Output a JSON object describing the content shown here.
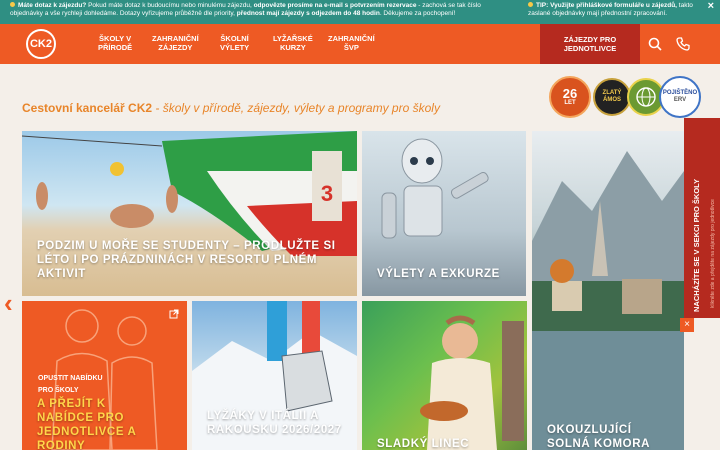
{
  "infobar": {
    "msg1_part1": "Máte dotaz k zájezdu? ",
    "msg1_part2": "Pokud máte dotaz k budoucímu nebo minulému zájezdu, ",
    "msg1_part3": "odpovězte prosíme na e-mail s potvrzením rezervace",
    "msg1_part4": " - zachová se tak číslo objednávky a vše rychleji dohledáme. Dotazy vyřizujeme průběžně dle priority, ",
    "msg1_part5": "přednost mají zájezdy s odjezdem do 48 hodin",
    "msg1_part6": ". Děkujeme za pochopení!",
    "msg2_part1": "TIP: Využijte přihláškové formuláře u zájezdů,",
    "msg2_part2": " takto zaslané objednávky mají přednostní zpracování.",
    "close": "×"
  },
  "nav": {
    "logo": "CK2",
    "items": [
      {
        "l1": "ŠKOLY V",
        "l2": "PŘÍRODĚ"
      },
      {
        "l1": "ZAHRANIČNÍ",
        "l2": "ZÁJEZDY"
      },
      {
        "l1": "ŠKOLNÍ",
        "l2": "VÝLETY"
      },
      {
        "l1": "LYŽAŘSKÉ",
        "l2": "KURZY"
      },
      {
        "l1": "ZAHRANIČNÍ",
        "l2": "ŠVP"
      }
    ],
    "jednotlivce_l1": "ZÁJEZDY PRO",
    "jednotlivce_l2": "JEDNOTLIVCE"
  },
  "heading": {
    "brand": "Cestovní kancelář CK2",
    "sub": " - školy v přírodě, zájezdy, výlety a programy pro školy"
  },
  "badges": {
    "years": "26",
    "years_unit": "LET",
    "zlaty": "ZLATÝ",
    "zlaty2": "ÁMOS",
    "pojisteno": "POJIŠTĚNO",
    "erv": "ERV"
  },
  "tiles": {
    "t1": "PODZIM U MOŘE SE STUDENTY – PRODLUŽTE SI LÉTO I PO PRÁZDNINÁCH V RESORTU PLNÉM AKTIVIT",
    "t2": "VÝLETY A EXKURZE",
    "t3_small1": "OPUSTIT NABÍDKU",
    "t3_small2": "PRO ŠKOLY",
    "t3": "A PŘEJÍT K NABÍDCE PRO JEDNOTLIVCE A RODINY",
    "t4": "LYŽÁKY V ITÁLII A RAKOUSKU 2026/2027",
    "t5": "SLADKÝ LINEC",
    "t6": "OKOUZLUJÍCÍ SOLNÁ KOMORA"
  },
  "side_tab": {
    "text": "NACHÁZÍTE SE V SEKCI PRO ŠKOLY",
    "small": "klikněte zde a přejděte na zájezdy pro jednotlivce",
    "close": "×"
  },
  "colors": {
    "brand_orange": "#ee5a24",
    "dark_red": "#b52a1f",
    "teal": "#2f8f83"
  }
}
